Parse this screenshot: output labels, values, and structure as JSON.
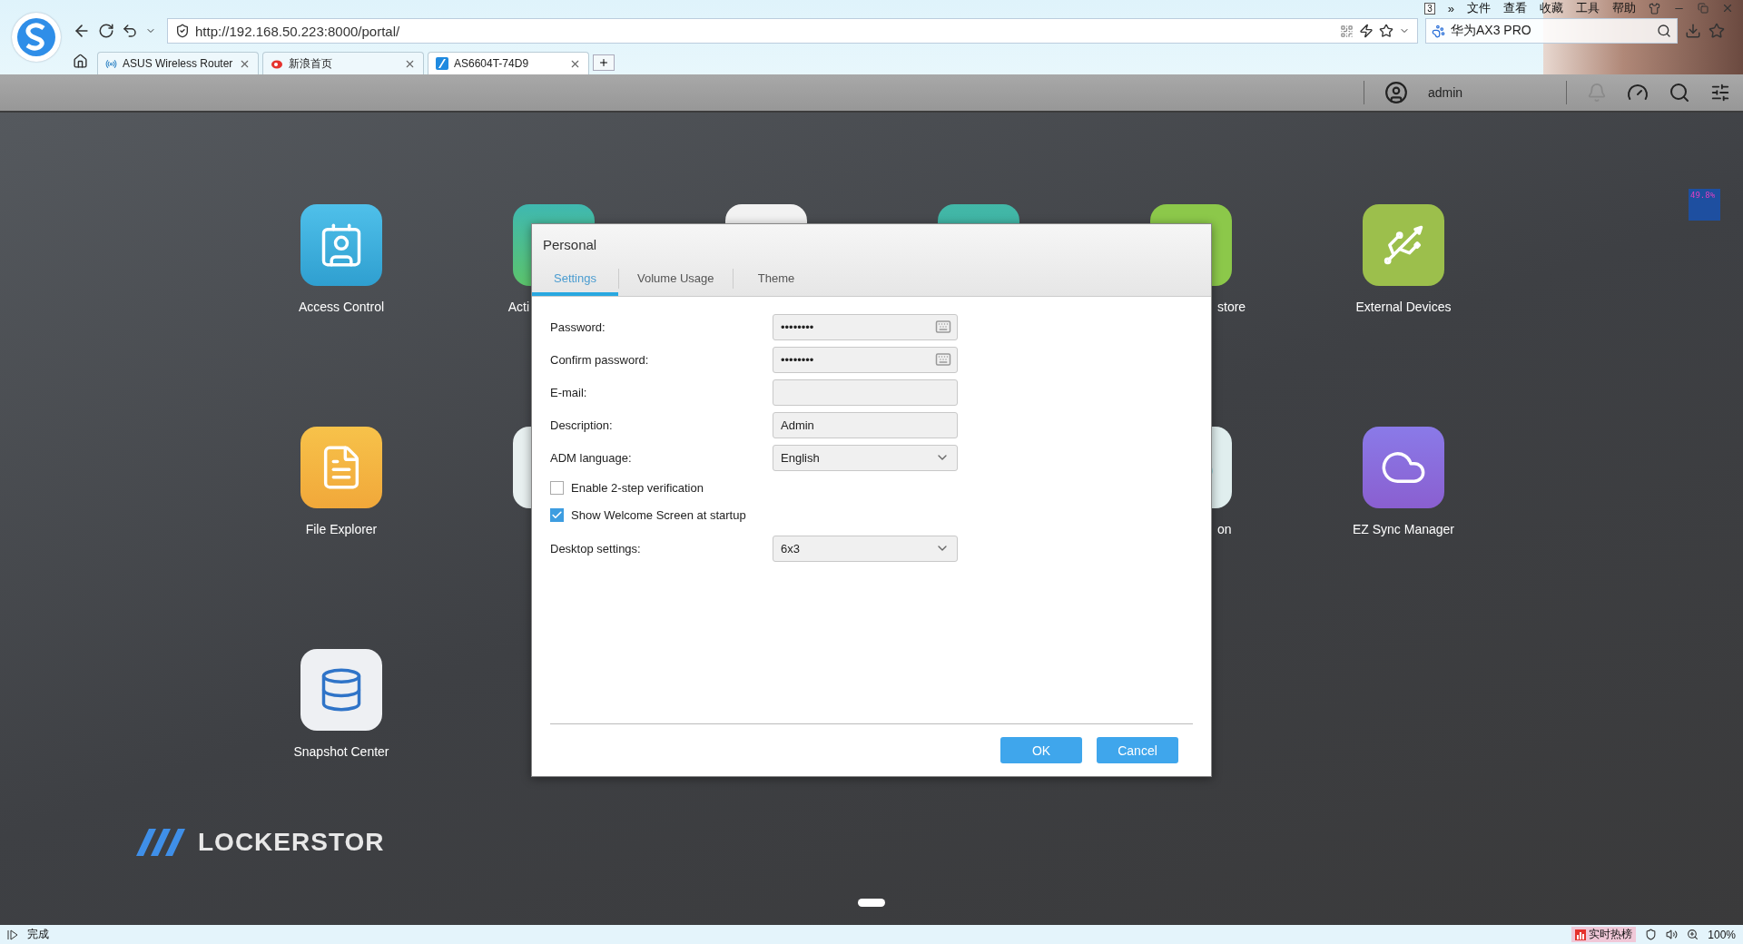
{
  "browser": {
    "tab_count": "3",
    "more": "»",
    "menu": [
      "文件",
      "查看",
      "收藏",
      "工具",
      "帮助"
    ],
    "address": "http://192.168.50.223:8000/portal/",
    "search": {
      "value": "华为AX3 PRO"
    },
    "tabs": [
      {
        "title": "ASUS Wireless Router",
        "kind": "router",
        "selected": false
      },
      {
        "title": "新浪首页",
        "kind": "sina",
        "selected": false
      },
      {
        "title": "AS6604T-74D9",
        "kind": "nas",
        "selected": true
      }
    ]
  },
  "topbar": {
    "user": "admin"
  },
  "desktop": {
    "rows": [
      [
        {
          "kind": "access",
          "label": "Access Control",
          "cut_end": false,
          "cut_start": false
        },
        {
          "kind": "activity",
          "label": "Acti",
          "cut_end": true,
          "cut_start": false
        },
        {
          "kind": "photos"
        },
        {
          "kind": "camera"
        },
        {
          "kind": "restore",
          "label": "store",
          "cut_end": false,
          "cut_start": true
        },
        {
          "kind": "usb",
          "label": "External Devices",
          "cut_end": false,
          "cut_start": false
        }
      ],
      [
        {
          "kind": "files",
          "label": "File Explorer",
          "cut_end": false,
          "cut_start": false
        },
        {
          "kind": "pale"
        },
        {
          "kind": "empty"
        },
        {
          "kind": "empty"
        },
        {
          "kind": "circle",
          "label": "on",
          "cut_end": false,
          "cut_start": true
        },
        {
          "kind": "sync",
          "label": "EZ Sync Manager",
          "cut_end": false,
          "cut_start": false
        }
      ],
      [
        {
          "kind": "snapshot",
          "label": "Snapshot Center",
          "cut_end": false,
          "cut_start": false
        }
      ]
    ]
  },
  "logo": "LOCKERSTOR",
  "meter": "49.8%",
  "dialog": {
    "title": "Personal",
    "tabs": [
      {
        "label": "Settings",
        "selected": true
      },
      {
        "label": "Volume Usage",
        "selected": false
      },
      {
        "label": "Theme",
        "selected": false
      }
    ],
    "fields": [
      {
        "kind": "password",
        "label": "Password:",
        "value": "••••••••"
      },
      {
        "kind": "password",
        "label": "Confirm password:",
        "value": "••••••••"
      },
      {
        "kind": "text",
        "label": "E-mail:"
      },
      {
        "kind": "text",
        "label": "Description:",
        "value": "Admin"
      },
      {
        "kind": "select",
        "label": "ADM language:",
        "value": "English"
      },
      {
        "kind": "checkbox",
        "label": "Enable 2-step verification",
        "checked": false
      },
      {
        "kind": "checkbox",
        "label": "Show Welcome Screen at startup",
        "checked": true
      },
      {
        "kind": "select",
        "label": "Desktop settings:",
        "value": "6x3"
      }
    ],
    "buttons": [
      "OK",
      "Cancel"
    ]
  },
  "status_bar": {
    "left": "完成",
    "hot": "实时热榜",
    "zoom": "100%"
  }
}
